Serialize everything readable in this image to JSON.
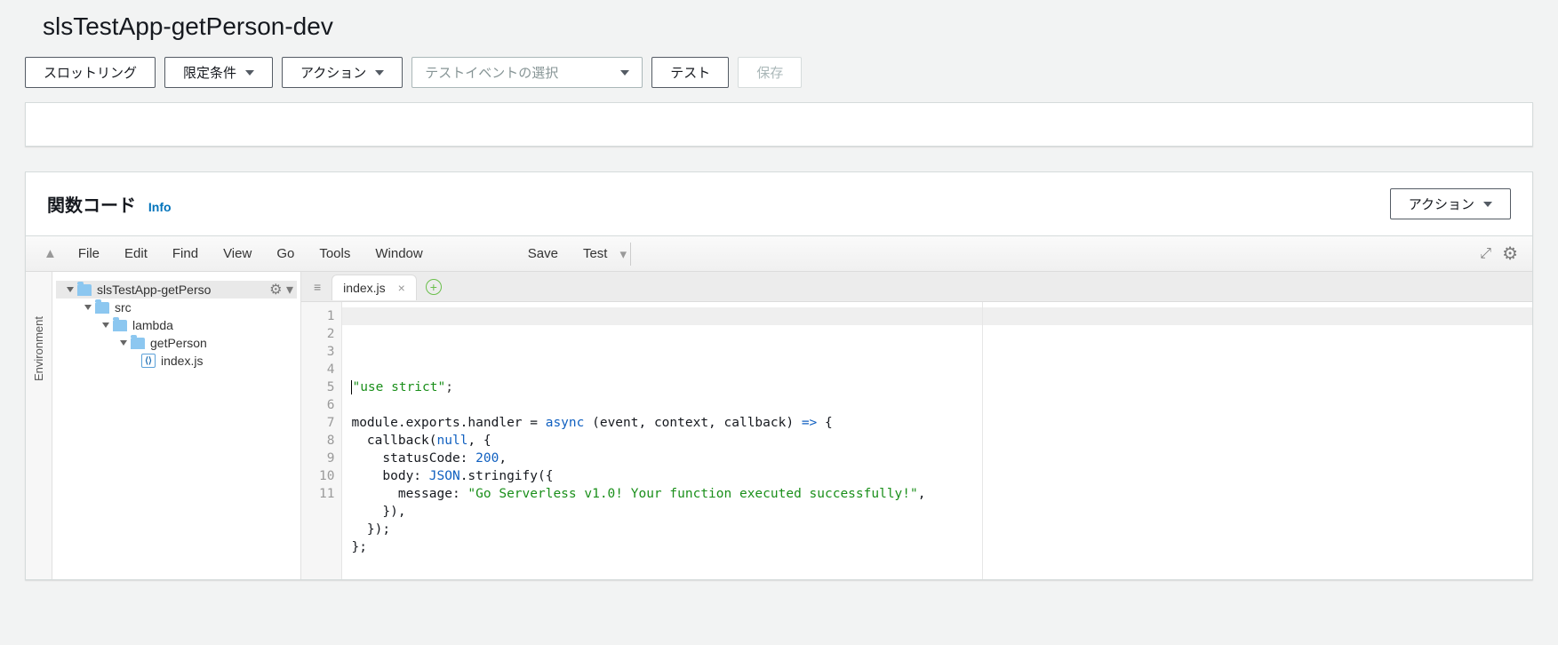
{
  "title": "slsTestApp-getPerson-dev",
  "toolbar": {
    "throttling": "スロットリング",
    "qualifiers": "限定条件",
    "actions": "アクション",
    "test_event_placeholder": "テストイベントの選択",
    "test": "テスト",
    "save": "保存"
  },
  "code_section": {
    "heading": "関数コード",
    "info": "Info",
    "actions": "アクション"
  },
  "ide_menu": {
    "file": "File",
    "edit": "Edit",
    "find": "Find",
    "view": "View",
    "go": "Go",
    "tools": "Tools",
    "window": "Window",
    "save": "Save",
    "test": "Test"
  },
  "env_label": "Environment",
  "tree": {
    "root": "slsTestApp-getPerso",
    "src": "src",
    "lambda": "lambda",
    "getPerson": "getPerson",
    "indexjs": "index.js"
  },
  "tab": {
    "name": "index.js"
  },
  "code_lines": [
    {
      "n": 1,
      "tokens": [
        {
          "t": "cursor"
        },
        {
          "t": "str",
          "v": "\"use strict\""
        },
        {
          "t": "punc",
          "v": ";"
        }
      ]
    },
    {
      "n": 2,
      "tokens": []
    },
    {
      "n": 3,
      "tokens": [
        {
          "t": "txt",
          "v": "module.exports.handler = "
        },
        {
          "t": "kw",
          "v": "async"
        },
        {
          "t": "txt",
          "v": " (event, context, callback) "
        },
        {
          "t": "kw",
          "v": "=>"
        },
        {
          "t": "txt",
          "v": " {"
        }
      ]
    },
    {
      "n": 4,
      "tokens": [
        {
          "t": "txt",
          "v": "  callback("
        },
        {
          "t": "kw",
          "v": "null"
        },
        {
          "t": "txt",
          "v": ", {"
        }
      ]
    },
    {
      "n": 5,
      "tokens": [
        {
          "t": "txt",
          "v": "    statusCode: "
        },
        {
          "t": "num",
          "v": "200"
        },
        {
          "t": "txt",
          "v": ","
        }
      ]
    },
    {
      "n": 6,
      "tokens": [
        {
          "t": "txt",
          "v": "    body: "
        },
        {
          "t": "id",
          "v": "JSON"
        },
        {
          "t": "txt",
          "v": ".stringify({"
        }
      ]
    },
    {
      "n": 7,
      "tokens": [
        {
          "t": "txt",
          "v": "      message: "
        },
        {
          "t": "str",
          "v": "\"Go Serverless v1.0! Your function executed successfully!\""
        },
        {
          "t": "txt",
          "v": ","
        }
      ]
    },
    {
      "n": 8,
      "tokens": [
        {
          "t": "txt",
          "v": "    }),"
        }
      ]
    },
    {
      "n": 9,
      "tokens": [
        {
          "t": "txt",
          "v": "  });"
        }
      ]
    },
    {
      "n": 10,
      "tokens": [
        {
          "t": "txt",
          "v": "};"
        }
      ]
    },
    {
      "n": 11,
      "tokens": []
    }
  ]
}
